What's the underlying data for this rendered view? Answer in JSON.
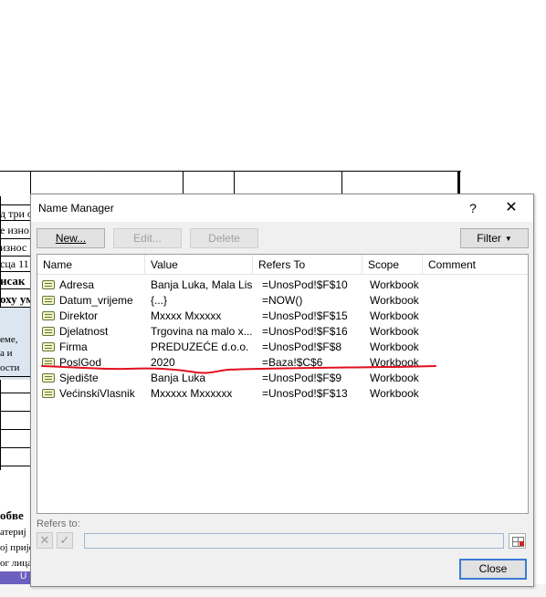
{
  "background": {
    "fragments": [
      "д три о",
      "е изно",
      "износ",
      "сца 11",
      "исак",
      "оху ум",
      "еме,",
      "а и",
      "ости",
      "обве",
      "атериј",
      "ој прије",
      "ог лица"
    ],
    "taskbar_label": "U"
  },
  "dialog": {
    "title": "Name Manager",
    "help_symbol": "?",
    "close_symbol": "✕",
    "buttons": {
      "new": "New...",
      "edit": "Edit...",
      "delete": "Delete",
      "filter": "Filter"
    },
    "columns": [
      "Name",
      "Value",
      "Refers To",
      "Scope",
      "Comment"
    ],
    "rows": [
      {
        "name": "Adresa",
        "value": "Banja Luka, Mala Lis...",
        "refers_to": "=UnosPod!$F$10",
        "scope": "Workbook",
        "comment": ""
      },
      {
        "name": "Datum_vrijeme",
        "value": "{...}",
        "refers_to": "=NOW()",
        "scope": "Workbook",
        "comment": ""
      },
      {
        "name": "Direktor",
        "value": "Mxxxx Mxxxxx",
        "refers_to": "=UnosPod!$F$15",
        "scope": "Workbook",
        "comment": ""
      },
      {
        "name": "Djelatnost",
        "value": "Trgovina na malo x...",
        "refers_to": "=UnosPod!$F$16",
        "scope": "Workbook",
        "comment": ""
      },
      {
        "name": "Firma",
        "value": " PREDUZEĆE d.o.o.",
        "refers_to": "=UnosPod!$F$8",
        "scope": "Workbook",
        "comment": ""
      },
      {
        "name": "PoslGod",
        "value": "2020",
        "refers_to": "=Baza!$C$6",
        "scope": "Workbook",
        "comment": ""
      },
      {
        "name": "Sjedište",
        "value": " Banja Luka",
        "refers_to": "=UnosPod!$F$9",
        "scope": "Workbook",
        "comment": ""
      },
      {
        "name": "VećinskiVlasnik",
        "value": "Mxxxxx Mxxxxxx",
        "refers_to": "=UnosPod!$F$13",
        "scope": "Workbook",
        "comment": ""
      }
    ],
    "refers_to_label": "Refers to:",
    "refers_to_value": "",
    "cancel_symbol": "✕",
    "confirm_symbol": "✓",
    "close_button": "Close",
    "annotation_color": "#e0101e"
  }
}
